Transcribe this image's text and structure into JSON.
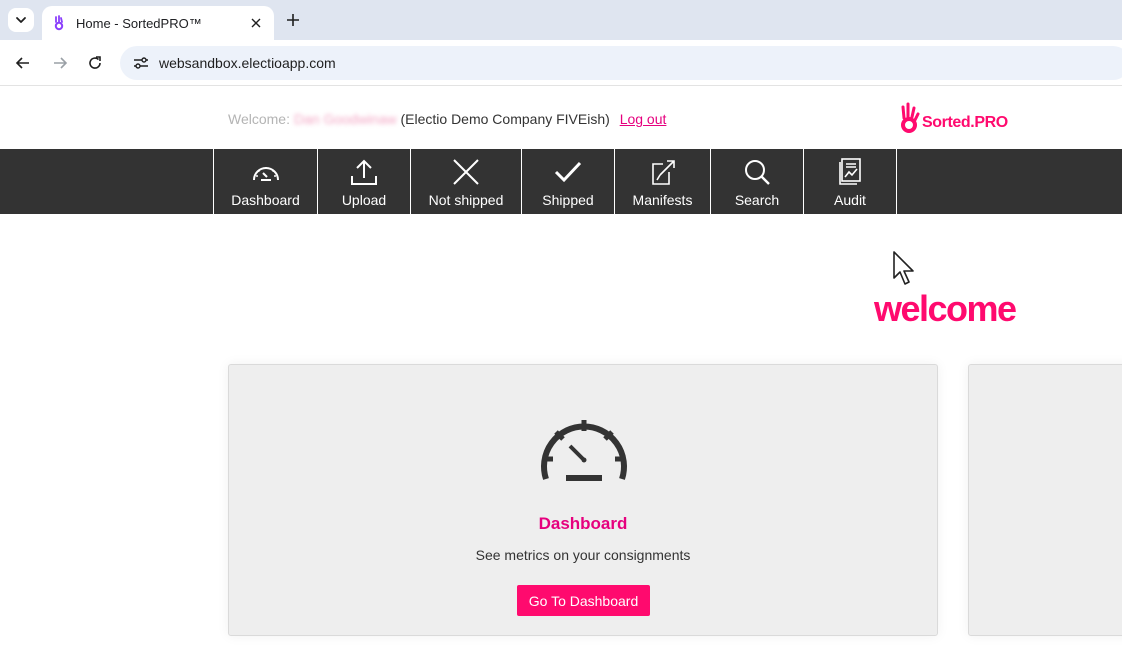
{
  "browser": {
    "tab_title": "Home - SortedPRO™",
    "url": "websandbox.electioapp.com"
  },
  "header": {
    "welcome_label": "Welcome:",
    "username": "Dan Goodwinaw",
    "company": "(Electio Demo Company FIVEish)",
    "logout_label": "Log out",
    "brand_name": "Sorted.PRO"
  },
  "nav": {
    "items": [
      {
        "label": "Dashboard",
        "icon": "gauge-icon"
      },
      {
        "label": "Upload",
        "icon": "upload-icon"
      },
      {
        "label": "Not shipped",
        "icon": "x-icon"
      },
      {
        "label": "Shipped",
        "icon": "check-icon"
      },
      {
        "label": "Manifests",
        "icon": "manifest-icon"
      },
      {
        "label": "Search",
        "icon": "search-icon"
      },
      {
        "label": "Audit",
        "icon": "audit-icon"
      }
    ]
  },
  "main": {
    "heading": "welcome",
    "cards": [
      {
        "icon": "gauge-icon",
        "title": "Dashboard",
        "description": "See metrics on your consignments",
        "button_label": "Go To Dashboard"
      }
    ]
  },
  "colors": {
    "accent": "#ff0a6e",
    "nav_bg": "#333333",
    "card_bg": "#eeeeee"
  }
}
